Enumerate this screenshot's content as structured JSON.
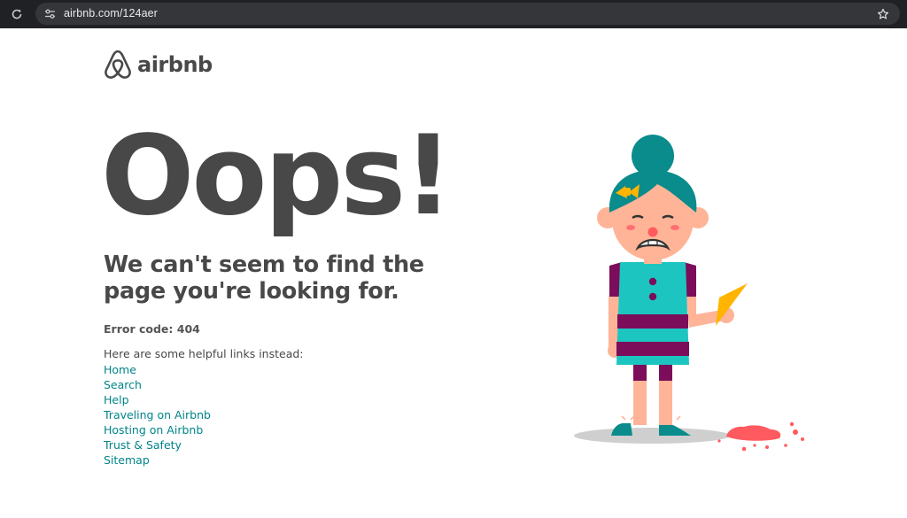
{
  "browser": {
    "url": "airbnb.com/124aer",
    "icons": [
      "reload-icon",
      "site-info-icon",
      "bookmark-star-icon"
    ]
  },
  "brand": {
    "name": "airbnb",
    "logo_icon": "airbnb-belo-icon"
  },
  "error_page": {
    "headline": "Oops!",
    "message": "We can't seem to find the page you're looking for.",
    "error_code": "Error code: 404",
    "links_intro": "Here are some helpful links instead:",
    "links": [
      {
        "label": "Home"
      },
      {
        "label": "Search"
      },
      {
        "label": "Help"
      },
      {
        "label": "Traveling on Airbnb"
      },
      {
        "label": "Hosting on Airbnb"
      },
      {
        "label": "Trust & Safety"
      },
      {
        "label": "Sitemap"
      }
    ],
    "illustration": "sad-girl-dropped-ice-cream-illustration"
  },
  "colors": {
    "chrome_bg": "#202124",
    "omnibox_bg": "#35363a",
    "text_dark": "#484848",
    "link": "#008489",
    "teal": "#1cc5c0",
    "purple": "#7b0d5a",
    "skin": "#ffb497",
    "ice_cream": "#ff5a5f",
    "cone": "#ffb400"
  }
}
